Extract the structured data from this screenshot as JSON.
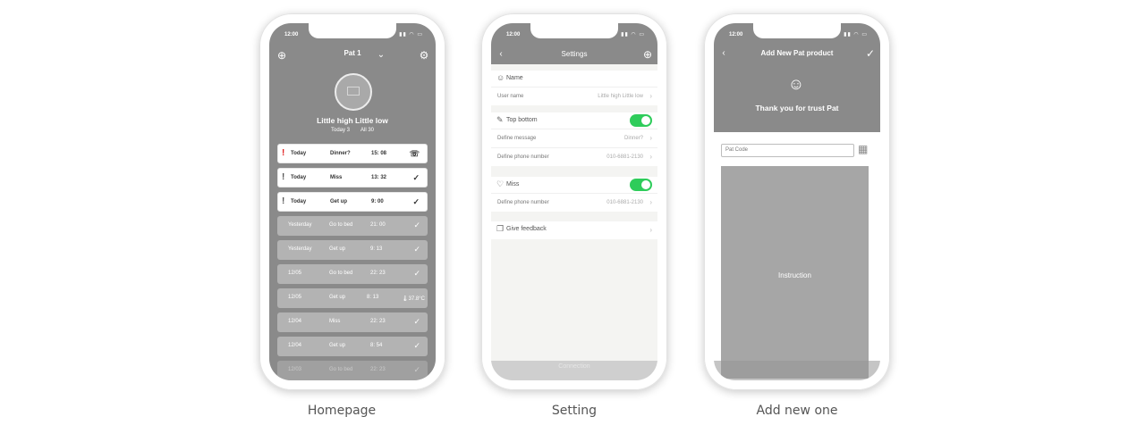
{
  "status": {
    "time": "12:00",
    "icons": "▮▮ ◠ ▭"
  },
  "homepage": {
    "caption": "Homepage",
    "pet_name": "Pat 1",
    "title": "Little high Little low",
    "today_count": "Today 3",
    "all_count": "All  30",
    "rows": [
      {
        "day": "Today",
        "event": "Dinner?",
        "time": "15: 08",
        "status": "phone-icon",
        "status_glyph": "☏"
      },
      {
        "day": "Today",
        "event": "Miss",
        "time": "13: 32",
        "status": "check-icon",
        "status_glyph": "✓"
      },
      {
        "day": "Today",
        "event": "Get up",
        "time": "9: 00",
        "status": "check-icon",
        "status_glyph": "✓"
      },
      {
        "day": "Yesterday",
        "event": "Go to bed",
        "time": "21: 00",
        "status": "check-icon",
        "status_glyph": "✓"
      },
      {
        "day": "Yesterday",
        "event": "Get up",
        "time": "9: 13",
        "status": "check-icon",
        "status_glyph": "✓"
      },
      {
        "day": "12/05",
        "event": "Go to bed",
        "time": "22: 23",
        "status": "check-icon",
        "status_glyph": "✓"
      },
      {
        "day": "12/05",
        "event": "Get up",
        "time": "8: 13",
        "status": "thermometer-icon",
        "status_glyph": "🌡37.8°C"
      },
      {
        "day": "12/04",
        "event": "Miss",
        "time": "22: 23",
        "status": "check-icon",
        "status_glyph": "✓"
      },
      {
        "day": "12/04",
        "event": "Get up",
        "time": "8: 54",
        "status": "check-icon",
        "status_glyph": "✓"
      },
      {
        "day": "12/03",
        "event": "Go to bed",
        "time": "22: 23",
        "status": "check-icon",
        "status_glyph": "✓"
      }
    ]
  },
  "settings": {
    "caption": "Setting",
    "title": "Settings",
    "name_section": {
      "label": "Name",
      "user_name_label": "User name",
      "user_name_value": "Little high Little low"
    },
    "top_bottom_section": {
      "label": "Top bottom",
      "message_label": "Define message",
      "message_value": "Dinner?",
      "phone_label": "Define phone number",
      "phone_value": "010-6881-2130"
    },
    "miss_section": {
      "label": "Miss",
      "phone_label": "Define phone number",
      "phone_value": "010-6881-2130"
    },
    "feedback_label": "Give feedback",
    "footer_text": "Connection"
  },
  "add_new": {
    "caption": "Add new one",
    "title": "Add New Pat product",
    "thanks": "Thank you for trust Pat",
    "code_placeholder": "Pat Code",
    "instruction": "Instruction"
  }
}
